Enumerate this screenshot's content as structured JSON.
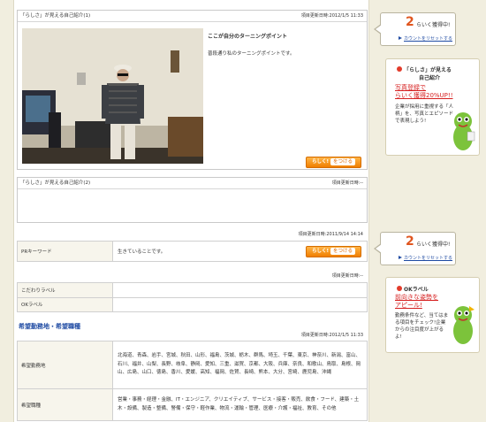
{
  "intro1": {
    "title": "「らしさ」が見える自己紹介(1)",
    "updated": "項目更新日時:2012/1/5 11:33",
    "heading": "ここが自分のターニングポイント",
    "body": "普段通り私のターニングポイントです。",
    "button_label": "らしく!",
    "button_inner": "をつける"
  },
  "intro2": {
    "title": "「らしさ」が見える自己紹介(2)",
    "updated": "項目更新日時:--"
  },
  "pr": {
    "updated": "項目更新日時:2011/9/14 14:14",
    "label": "PRキーワード",
    "value": "生きていることです。",
    "button_label": "らしく!",
    "button_inner": "をつける"
  },
  "kodawari": {
    "updated": "項目更新日時:--",
    "rows": [
      {
        "label": "こだわりラベル",
        "value": ""
      },
      {
        "label": "OKラベル",
        "value": ""
      }
    ]
  },
  "desired": {
    "title": "希望勤務地・希望職種",
    "updated": "項目更新日時:2012/1/5 11:33",
    "location_label": "希望勤務地",
    "location_value": "北海道、青森、岩手、宮城、秋田、山形、福島、茨城、栃木、群馬、埼玉、千葉、東京、神奈川、新潟、富山、石川、福井、山梨、長野、岐阜、静岡、愛知、三重、滋賀、京都、大阪、兵庫、奈良、和歌山、鳥取、島根、岡山、広島、山口、徳島、香川、愛媛、高知、福岡、佐賀、長崎、熊本、大分、宮崎、鹿児島、沖縄",
    "job_label": "希望職種",
    "job_value": "営業・事務・経理・金融、IT・エンジニア、クリエイティブ、サービス・接客・販売、飲食・フード、建築・土木・設備、製造・整備、警備・保守・軽作業、物流・運輸・管理、医療・介護・福祉、教育、その他"
  },
  "callout1": {
    "number": "2",
    "count_text": "らいく獲得中!",
    "link": "カウントをリセットする"
  },
  "callout2": {
    "number": "2",
    "count_text": "らいく獲得中!",
    "link": "カウントをリセットする"
  },
  "promo1": {
    "title_line1": "「らしさ」が見える",
    "title_line2": "自己紹介",
    "red_line1": "写真登録で",
    "red_line2": "らいく獲得20%UP!!",
    "text": "企業が採用に重視する「人柄」を、写真とエピソードで表現しよう!"
  },
  "promo2": {
    "title": "OKラベル",
    "red_line1": "前向きな姿勢を",
    "red_line2": "アピール!",
    "text": "勤務条件など、当てはまる項目をチェック!企業からの注目度が上がるよ!"
  },
  "colors": {
    "accent_orange": "#f07f00",
    "link_blue": "#1f4ba3",
    "red": "#d61f1f",
    "bg": "#f1eedf"
  }
}
